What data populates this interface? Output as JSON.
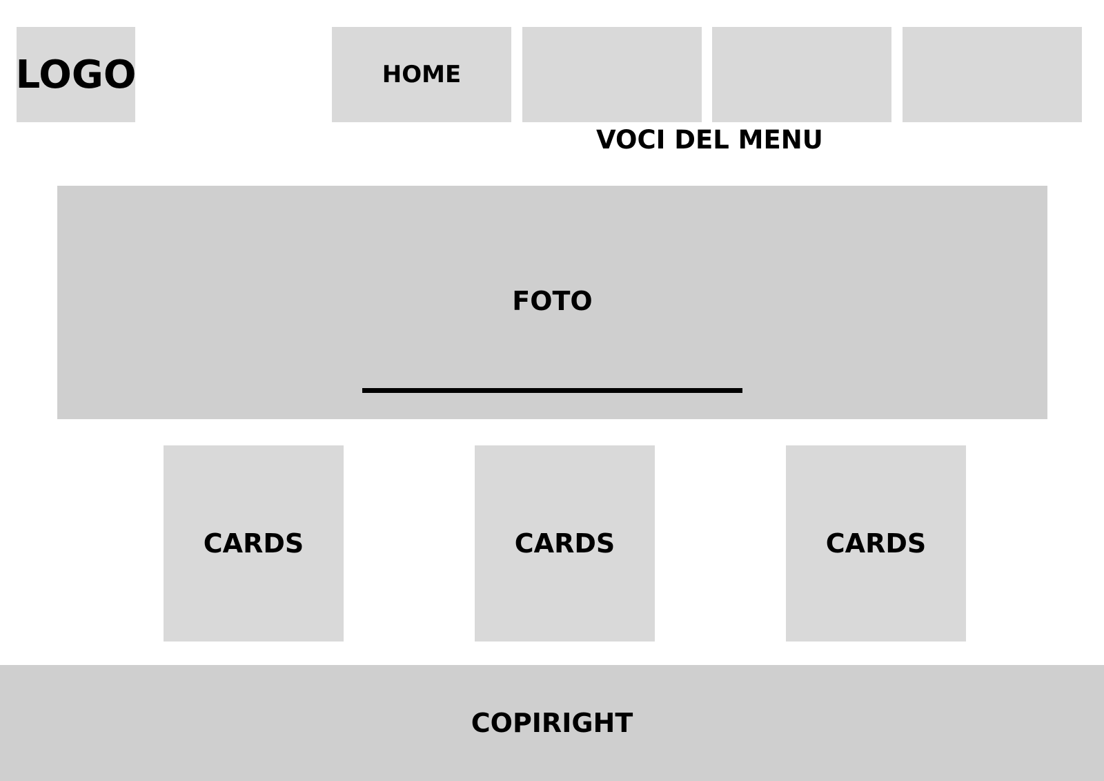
{
  "header": {
    "logo_label": "LOGO",
    "nav_items": [
      {
        "label": "HOME"
      },
      {
        "label": ""
      },
      {
        "label": ""
      },
      {
        "label": ""
      }
    ],
    "menu_caption": "VOCI DEL MENU"
  },
  "hero": {
    "label": "FOTO"
  },
  "cards": [
    {
      "label": "CARDS"
    },
    {
      "label": "CARDS"
    },
    {
      "label": "CARDS"
    }
  ],
  "footer": {
    "label": "COPIRIGHT"
  },
  "colors": {
    "placeholder_light": "#d9d9d9",
    "placeholder_dark": "#cfcfcf",
    "text": "#000000",
    "background": "#ffffff"
  }
}
